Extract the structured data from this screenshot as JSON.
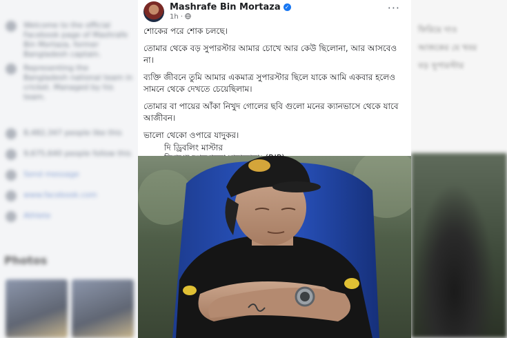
{
  "background_left": {
    "rows": [
      "Welcome to the official Facebook page of Mashrafe Bin Mortaza, former Bangladesh captain.",
      "Representing the Bangladesh national team in cricket. Managed by his team.",
      "8,482,347 people like this",
      "9,675,640 people follow this",
      "Send message",
      "www.facebook.com",
      "Athlete"
    ],
    "photos_heading": "Photos"
  },
  "background_right": {
    "lines": [
      "ফিরিয়ে দাও",
      "আজকের যে খবর",
      "বড় সুপারস্টার"
    ]
  },
  "post": {
    "author": "Mashrafe Bin Mortaza",
    "time": "1h",
    "more_label": "···",
    "paragraphs": [
      "শোকের পরে শোক চলছে।",
      "তোমার থেকে বড় সুপারস্টার আমার চোখে আর কেউ ছিলোনা, আর আসবেও না।",
      "ব্যক্তি জীবনে তুমি আমার একমাত্র সুপারস্টার ছিলে যাকে আমি একবার হলেও সামনে থেকে দেখতে চেয়েছিলাম।",
      "তোমার বা পায়ের আঁকা নিখুদ গোলের ছবি গুলো মনের ক্যানভাসে থেকে যাবে আজীবন।",
      "ভালো থেকো ওপারে যাদুকর।"
    ],
    "signature": [
      "দি ড্রিবলিং মাস্টার",
      "দিয়াগো আরমান্দো মারাদোনা। (RIP)"
    ]
  },
  "colors": {
    "verified": "#1877f2",
    "meta": "#65676b",
    "text": "#1c1e21"
  },
  "icons": {
    "verified": "verified-badge-icon",
    "globe": "globe-icon",
    "more": "more-options-icon"
  }
}
